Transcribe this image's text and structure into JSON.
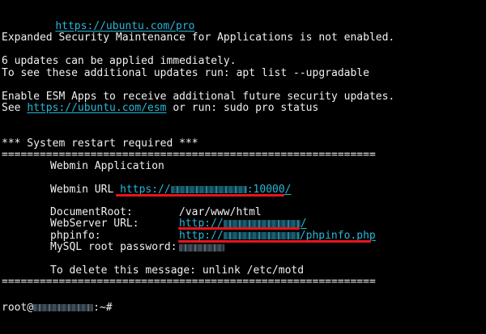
{
  "terminal": {
    "pro_link": "https://ubuntu.com/pro",
    "esm_apps_status": "Expanded Security Maintenance for Applications is not enabled.",
    "updates_line": "6 updates can be applied immediately.",
    "upgradable_line": "To see these additional updates run: apt list --upgradable",
    "esm_enable_line": "Enable ESM Apps to receive additional future security updates.",
    "see_prefix": "See ",
    "esm_link": "https://ubuntu.com/esm",
    "see_suffix": " or run: sudo pro status",
    "restart_notice": "*** System restart required ***",
    "separator": "===========================================================",
    "webmin_heading": "Webmin Application",
    "webmin_url_label": "Webmin URL ",
    "webmin_url_prefix": "https://",
    "webmin_url_suffix": ":10000/",
    "docroot_label": "DocumentRoot:",
    "docroot_value": "/var/www/html",
    "webserver_label": "WebServer URL:",
    "webserver_prefix": "http://",
    "webserver_suffix": "/",
    "phpinfo_label": "phpinfo:",
    "phpinfo_prefix": "http://",
    "phpinfo_suffix": "/phpinfo.php",
    "mysql_label": "MySQL root password:",
    "motd_line": "To delete this message: unlink /etc/motd",
    "prompt_user": "root@",
    "prompt_suffix": ":~#"
  },
  "colors": {
    "background": "#000000",
    "text": "#f0f0f0",
    "link": "#27b8d8",
    "annotation_underline": "#e8141c"
  }
}
